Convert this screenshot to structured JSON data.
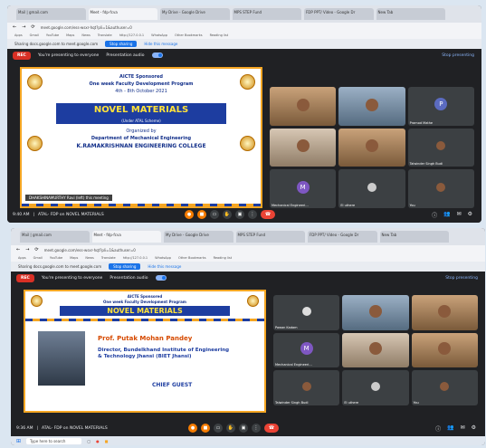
{
  "screens": {
    "top": {
      "tabs": [
        "Mail | gmail.com",
        "Meet - fdp-fcva",
        "My Drive - Google Drive",
        "MPS STEP Fund",
        "FDP PPT/ Video - Google Dr",
        "New Tab"
      ],
      "url": "meet.google.com/ess-wsxr-hqt?pli=1&authuser=0",
      "bookmarks": [
        "Apps",
        "Gmail",
        "YouTube",
        "Maps",
        "News",
        "Translate",
        "http://127.0.0.1",
        "WhatsApp",
        "Other Bookmarks",
        "Reading list"
      ],
      "share_text": "Sharing docs.google.com to meet.google.com",
      "share_stop": "Stop sharing",
      "share_hide": "Hide this message",
      "rec": "REC",
      "presenting_text": "You're presenting to everyone",
      "presentation_audio": "Presentation audio",
      "stop_presenting": "Stop presenting",
      "slide": {
        "line1": "AICTE Sponsored",
        "line2": "One week Faculty Development Program",
        "line3": "4th - 8th October 2021",
        "banner": "NOVEL MATERIALS",
        "subbanner": "(Under ATAL Scheme)",
        "organized": "Organized by",
        "dept": "Department of Mechanical Engineering",
        "college": "K.RAMAKRISHNAN ENGINEERING COLLEGE",
        "caption": "DHAKSHINAMURTHY Ravi (left) this meeting"
      },
      "tiles": [
        {
          "name": "",
          "style": "room"
        },
        {
          "name": "",
          "style": "room3"
        },
        {
          "name": "Pramod Mathe",
          "avatar": "P",
          "color": "#5b6bc0"
        },
        {
          "name": "",
          "style": "room2"
        },
        {
          "name": "",
          "style": "room"
        },
        {
          "name": "Talwinder Singh Budi",
          "style": "dark"
        },
        {
          "name": "Mechanical Engineeri...",
          "avatar": "M",
          "color": "#7e57c2"
        },
        {
          "name": "El uthere",
          "style": "dark"
        },
        {
          "name": "You",
          "style": "dark"
        }
      ],
      "time": "9:40 AM",
      "meeting": "ATAL- FDP on NOVEL MATERIALS"
    },
    "bottom": {
      "tabs": [
        "Mail | gmail.com",
        "Meet - fdp-fcva",
        "My Drive - Google Drive",
        "MPS STEP Fund",
        "FDP PPT/ Video - Google Dr",
        "New Tab"
      ],
      "url": "meet.google.com/ess-wsxr-hqt?pli=1&authuser=0",
      "bookmarks": [
        "Apps",
        "Gmail",
        "YouTube",
        "Maps",
        "News",
        "Translate",
        "http://127.0.0.1",
        "WhatsApp",
        "Other Bookmarks",
        "Reading list"
      ],
      "share_text": "Sharing docs.google.com to meet.google.com",
      "share_stop": "Stop sharing",
      "share_hide": "Hide this message",
      "rec": "REC",
      "presenting_text": "You're presenting to everyone",
      "presentation_audio": "Presentation audio",
      "stop_presenting": "Stop presenting",
      "slide": {
        "line1": "AICTE Sponsored",
        "line2": "One week Faculty Development Program",
        "banner": "NOVEL MATERIALS",
        "speaker": "Prof. Putak Mohan Pandey",
        "director": "Director, Bundelkhand Institute of Engineering & Technology Jhansi (BIET Jhansi)",
        "chief": "CHIEF GUEST"
      },
      "tiles": [
        {
          "name": "Pawan Kadam",
          "style": "dark"
        },
        {
          "name": "",
          "style": "room3"
        },
        {
          "name": "",
          "style": "room"
        },
        {
          "name": "Mechanical Engineeri...",
          "avatar": "M",
          "color": "#7e57c2"
        },
        {
          "name": "",
          "style": "room2"
        },
        {
          "name": "",
          "style": "room"
        },
        {
          "name": "Talwinder Singh Budi",
          "style": "dark"
        },
        {
          "name": "El uthere",
          "style": "dark"
        },
        {
          "name": "You",
          "style": "dark"
        }
      ],
      "time": "9:36 AM",
      "meeting": "ATAL- FDP on NOVEL MATERIALS",
      "taskbar_search": "Type here to search"
    }
  }
}
